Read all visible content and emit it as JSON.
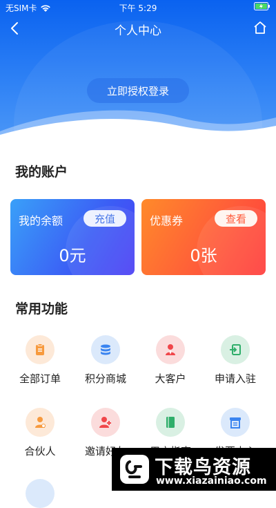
{
  "status_bar": {
    "carrier": "无SIM卡",
    "time": "下午 5:29"
  },
  "nav": {
    "title": "个人中心"
  },
  "login": {
    "button_label": "立即授权登录"
  },
  "account": {
    "section_title": "我的账户",
    "balance": {
      "label": "我的余额",
      "button": "充值",
      "value": "0元"
    },
    "coupon": {
      "label": "优惠券",
      "button": "查看",
      "value": "0张"
    }
  },
  "functions": {
    "section_title": "常用功能",
    "items": [
      {
        "label": "全部订单",
        "icon": "clipboard-icon",
        "color": "#f79a3e",
        "bg": "#fde9d8"
      },
      {
        "label": "积分商城",
        "icon": "coins-icon",
        "color": "#3a84f0",
        "bg": "#dbe9fb"
      },
      {
        "label": "大客户",
        "icon": "vip-user-icon",
        "color": "#f0464a",
        "bg": "#fbdcdc"
      },
      {
        "label": "申请入驻",
        "icon": "enter-icon",
        "color": "#2fae6a",
        "bg": "#d9f0e3"
      },
      {
        "label": "合伙人",
        "icon": "partner-icon",
        "color": "#f79a3e",
        "bg": "#fde9d8"
      },
      {
        "label": "邀请好友",
        "icon": "invite-friend-icon",
        "color": "#f0464a",
        "bg": "#fbdcdc"
      },
      {
        "label": "用户指南",
        "icon": "book-icon",
        "color": "#2fae6a",
        "bg": "#d9f0e3"
      },
      {
        "label": "发票中心",
        "icon": "invoice-icon",
        "color": "#3a84f0",
        "bg": "#dbe9fb"
      }
    ]
  },
  "watermark": {
    "title": "下载鸟资源",
    "url": "www.xiazainiao.com"
  }
}
